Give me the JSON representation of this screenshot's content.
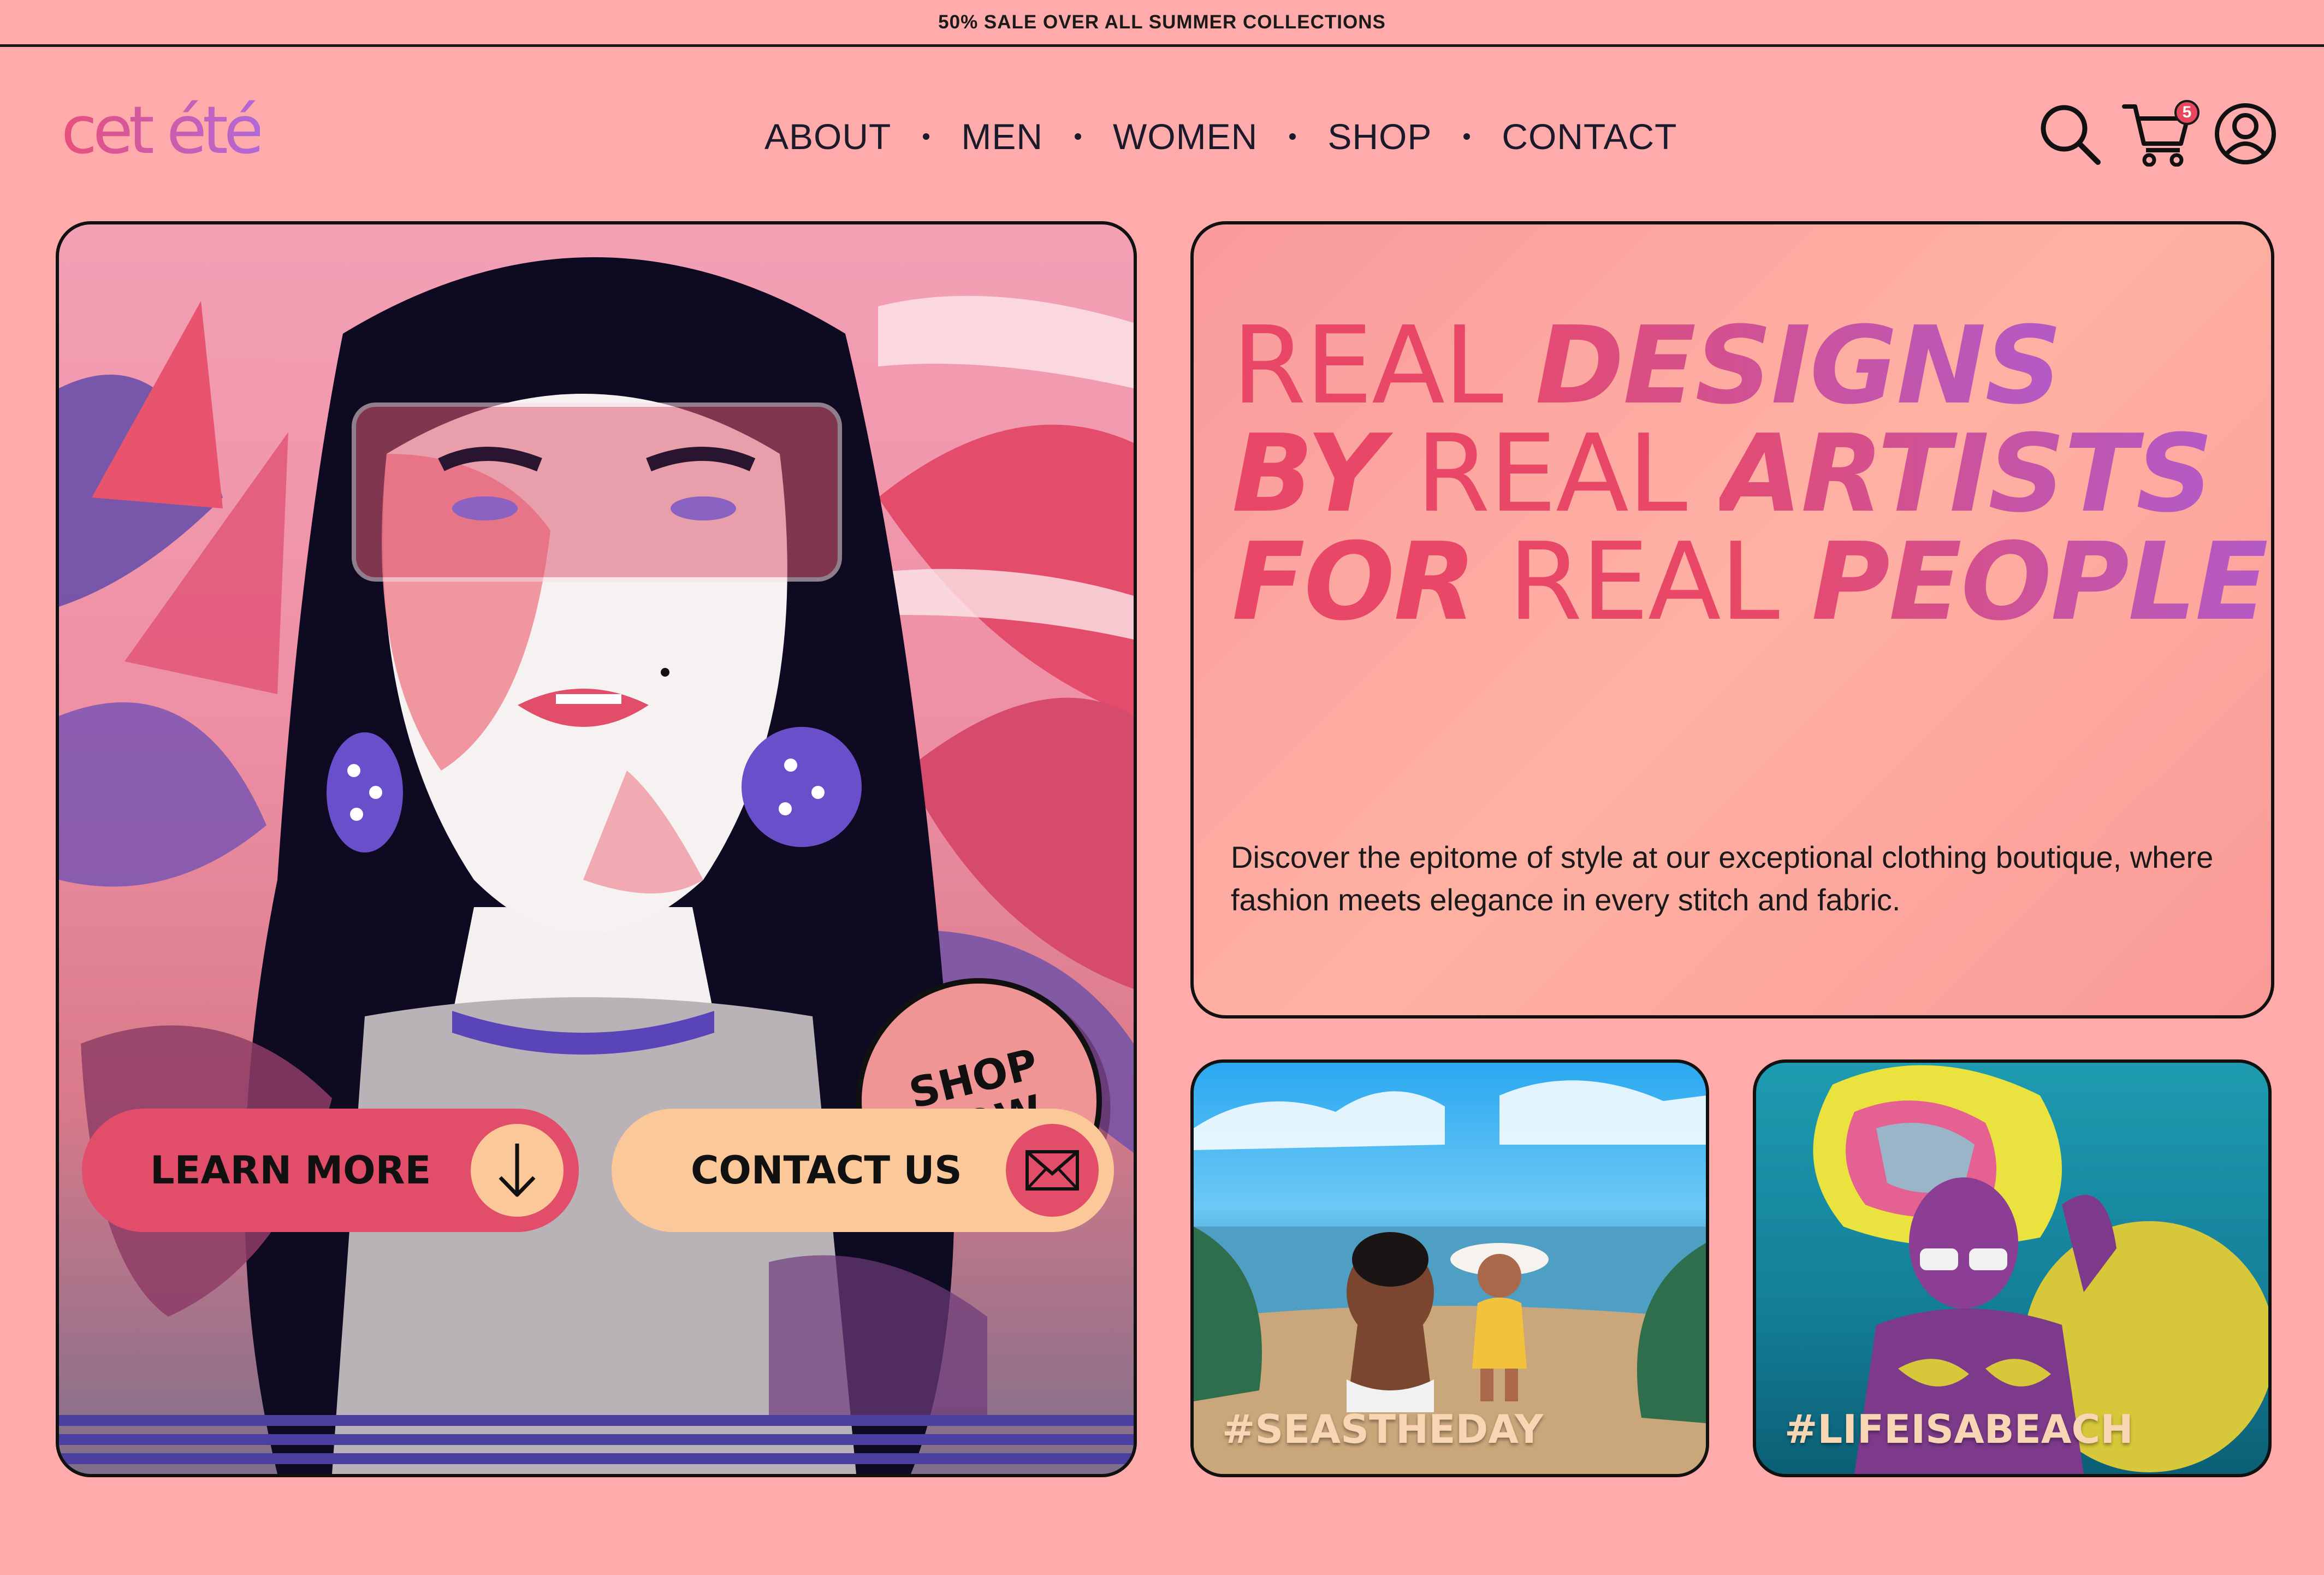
{
  "announcement": "50% SALE OVER ALL SUMMER COLLECTIONS",
  "brand": {
    "logo": "cet été"
  },
  "nav": {
    "items": [
      "ABOUT",
      "MEN",
      "WOMEN",
      "SHOP",
      "CONTACT"
    ]
  },
  "header_icons": {
    "search": "search-icon",
    "cart": "cart-icon",
    "cart_count": "5",
    "account": "user-icon"
  },
  "hero": {
    "shop_now_line1": "SHOP",
    "shop_now_line2": "NOW",
    "learn_more": "LEARN MORE",
    "contact_us": "CONTACT US",
    "learn_icon": "arrow-down-icon",
    "contact_icon": "mail-icon"
  },
  "headline": {
    "line1_a": "REAL",
    "line1_b": "DESIGNS",
    "line2_a": "BY",
    "line2_b": "REAL",
    "line2_c": "ARTISTS",
    "line3_a": "FOR",
    "line3_b": "REAL",
    "line3_c": "PEOPLE"
  },
  "description": "Discover the epitome of style at our exceptional clothing boutique, where fashion meets elegance in every stitch and fabric.",
  "gallery": [
    {
      "tag": "#SEASTHEDAY"
    },
    {
      "tag": "#LIFEISABEACH"
    }
  ],
  "colors": {
    "background": "#ffabab",
    "accent_pink": "#e24d6a",
    "accent_peach": "#fbc89a",
    "accent_purple": "#b35ac6"
  }
}
